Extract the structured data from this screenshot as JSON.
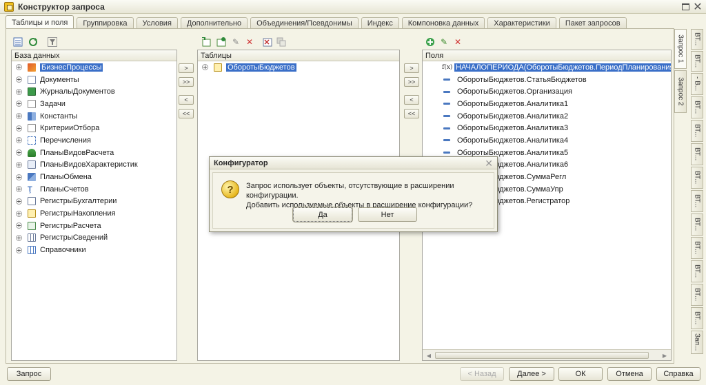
{
  "window": {
    "title": "Конструктор запроса"
  },
  "tabs": [
    "Таблицы и поля",
    "Группировка",
    "Условия",
    "Дополнительно",
    "Объединения/Псевдонимы",
    "Индекс",
    "Компоновка данных",
    "Характеристики",
    "Пакет запросов"
  ],
  "database_panel": {
    "header": "База данных",
    "items": [
      "БизнесПроцессы",
      "Документы",
      "ЖурналыДокументов",
      "Задачи",
      "Константы",
      "КритерииОтбора",
      "Перечисления",
      "ПланыВидовРасчета",
      "ПланыВидовХарактеристик",
      "ПланыОбмена",
      "ПланыСчетов",
      "РегистрыБухгалтерии",
      "РегистрыНакопления",
      "РегистрыРасчета",
      "РегистрыСведений",
      "Справочники"
    ]
  },
  "tables_panel": {
    "header": "Таблицы",
    "items": [
      "ОборотыБюджетов"
    ]
  },
  "fields_panel": {
    "header": "Поля",
    "fx_label": "f(x)",
    "items": [
      "НАЧАЛОПЕРИОДА(ОборотыБюджетов.ПериодПланирования, МЕС",
      "ОборотыБюджетов.СтатьяБюджетов",
      "ОборотыБюджетов.Организация",
      "ОборотыБюджетов.Аналитика1",
      "ОборотыБюджетов.Аналитика2",
      "ОборотыБюджетов.Аналитика3",
      "ОборотыБюджетов.Аналитика4",
      "ОборотыБюджетов.Аналитика5",
      "ОборотыБюджетов.Аналитика6",
      "ОборотыБюджетов.СуммаРегл",
      "ОборотыБюджетов.СуммаУпр",
      "ОборотыБюджетов.Регистратор"
    ]
  },
  "move_buttons": {
    "one": ">",
    "all": ">>",
    "back": "<",
    "back_all": "<<"
  },
  "side_tabs": {
    "left": [
      "Запрос 1",
      "Запрос 2"
    ],
    "right": [
      "ВТ...",
      "ВТ...",
      "- В...",
      "ВТ...",
      "ВТ...",
      "ВТ...",
      "ВТ...",
      "ВТ...",
      "ВТ...",
      "ВТ...",
      "ВТ...",
      "ВТ...",
      "ВТ...",
      "Зап..."
    ]
  },
  "dialog": {
    "title": "Конфигуратор",
    "line1": "Запрос использует объекты, отсутствующие в расширении конфигурации.",
    "line2": "Добавить используемые объекты в расширение конфигурации?",
    "yes": "Да",
    "no": "Нет"
  },
  "bottom_buttons": {
    "query": "Запрос",
    "back": "< Назад",
    "next": "Далее >",
    "ok": "ОК",
    "cancel": "Отмена",
    "help": "Справка"
  }
}
